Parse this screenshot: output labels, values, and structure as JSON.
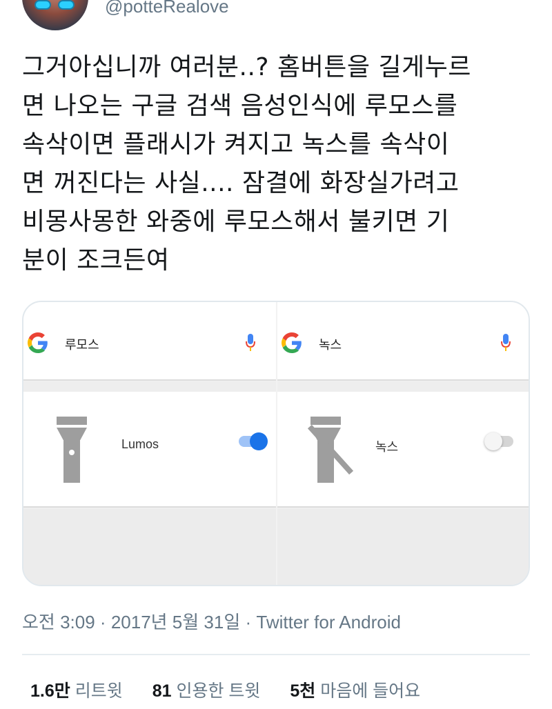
{
  "author": {
    "handle": "@potteRealove"
  },
  "tweet": {
    "text": "그거아십니까 여러분..? 홈버튼을 길게누르\n면 나오는 구글 검색 음성인식에 루모스를\n속삭이면 플래시가 켜지고 녹스를 속삭이\n면 꺼진다는 사실.... 잠결에 화장실가려고\n비몽사몽한 와중에 루모스해서 불키면 기\n분이 조크든여"
  },
  "media": {
    "left_panel": {
      "query": "루모스",
      "card_label": "Lumos",
      "toggle_on": true
    },
    "right_panel": {
      "query": "녹스",
      "card_label": "녹스",
      "toggle_on": false
    },
    "colors": {
      "google_blue": "#4285F4",
      "google_red": "#EA4335",
      "google_yellow": "#FBBC05",
      "google_green": "#34A853",
      "toggle_on": "#1a73e8"
    }
  },
  "meta": {
    "time": "오전 3:09",
    "date": "2017년 5월 31일",
    "client": "Twitter for Android",
    "separator": "·"
  },
  "stats": {
    "retweets": {
      "count": "1.6만",
      "label": "리트윗"
    },
    "quotes": {
      "count": "81",
      "label": "인용한 트윗"
    },
    "likes": {
      "count": "5천",
      "label": "마음에 들어요"
    }
  }
}
